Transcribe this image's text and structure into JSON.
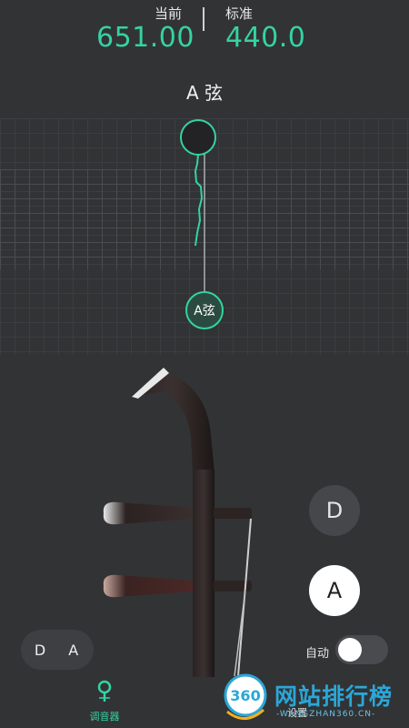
{
  "readout": {
    "current_label": "当前",
    "current_value": "651.00",
    "standard_label": "标准",
    "standard_value": "440.0"
  },
  "tuner": {
    "string_title": "A 弦",
    "target_label": "A弦"
  },
  "controls": {
    "string_d": "D",
    "string_a": "A",
    "strings_pill": "D A",
    "auto_label": "自动",
    "auto_on": false
  },
  "tabbar": {
    "tuner_label": "调音器",
    "settings_label": "设置"
  },
  "watermark": {
    "text": "网站排行榜",
    "badge": "360",
    "sub": "-WANGZHAN360.CN-"
  },
  "colors": {
    "accent": "#34d3a0",
    "background": "#323335"
  }
}
